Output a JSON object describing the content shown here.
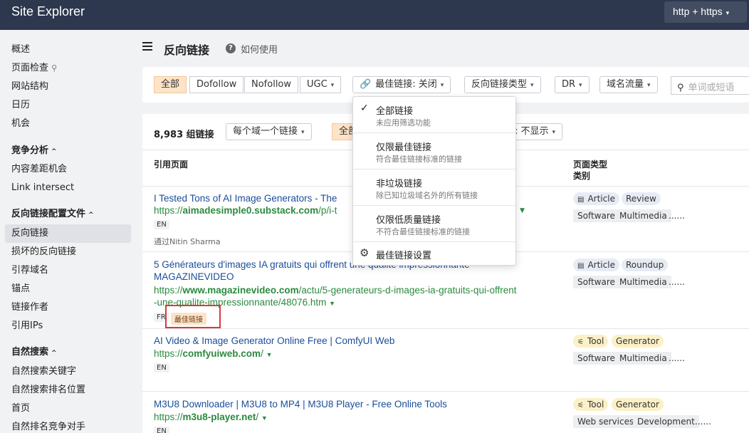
{
  "app": {
    "title": "Site Explorer",
    "protocol": "http + https"
  },
  "sidebar": {
    "items_top": [
      "概述",
      "页面检查",
      "网站结构",
      "日历",
      "机会"
    ],
    "section_competitive": {
      "label": "竞争分析",
      "items": [
        "内容差距机会",
        "Link intersect"
      ]
    },
    "section_backlinks": {
      "label": "反向链接配置文件",
      "items": [
        "反向链接",
        "损坏的反向链接",
        "引荐域名",
        "锚点",
        "链接作者",
        "引用IPs"
      ]
    },
    "section_organic": {
      "label": "自然搜索",
      "items": [
        "自然搜索关键字",
        "自然搜索排名位置",
        "首页",
        "自然排名竞争对手"
      ]
    }
  },
  "header": {
    "title": "反向链接",
    "help": "如何使用"
  },
  "filters": {
    "all": "全部",
    "dofollow": "Dofollow",
    "nofollow": "Nofollow",
    "ugc": "UGC",
    "best_links": "最佳链接: 关闭",
    "link_type": "反向链接类型",
    "dr": "DR",
    "domain_traffic": "域名流量",
    "search_placeholder": "单词或短语"
  },
  "table": {
    "count": "8,983 组链接",
    "group_select": "每个域一个链接",
    "all_btn": "全部",
    "hidden_select": ": 不显示",
    "col_ref_page": "引用页面",
    "col_page_type": "页面类型",
    "col_category": "类别",
    "rows": [
      {
        "title": "I Tested Tons of AI Image Generators - The",
        "url_prefix": "https://",
        "url_domain": "aimadesimple0.substack.com",
        "url_path": "/p/i-t",
        "lang": "EN",
        "via": "通过Nitin Sharma",
        "type_tags": [
          "Article",
          "Review"
        ],
        "cat_tags": [
          "Software",
          "Multimedia"
        ],
        "more": "......"
      },
      {
        "title_line1": "5 Générateurs d'images IA gratuits qui offrent une qualité impressionnante",
        "title_line2": "MAGAZINEVIDEO",
        "url_prefix": "https://",
        "url_domain": "www.magazinevideo.com",
        "url_path": "/actu/5-generateurs-d-images-ia-gratuits-qui-offrent",
        "url_line2": "-une-qualite-impressionnante/48076.htm",
        "lang": "FR",
        "best_tag": "最佳链接",
        "type_tags": [
          "Article",
          "Roundup"
        ],
        "cat_tags": [
          "Software",
          "Multimedia"
        ],
        "more": "......"
      },
      {
        "title": "AI Video & Image Generator Online Free | ComfyUI Web",
        "url_prefix": "https://",
        "url_domain": "comfyuiweb.com",
        "url_path": "/",
        "lang": "EN",
        "type_tags": [
          "Tool",
          "Generator"
        ],
        "cat_tags": [
          "Software",
          "Multimedia"
        ],
        "more": "......"
      },
      {
        "title": "M3U8 Downloader | M3U8 to MP4 | M3U8 Player - Free Online Tools",
        "url_prefix": "https://",
        "url_domain": "m3u8-player.net",
        "url_path": "/",
        "lang": "EN",
        "type_tags": [
          "Tool",
          "Generator"
        ],
        "cat_tags": [
          "Web services",
          "Development"
        ],
        "more": "......"
      }
    ]
  },
  "menu": {
    "items": [
      {
        "title": "全部链接",
        "sub": "未应用筛选功能"
      },
      {
        "title": "仅限最佳链接",
        "sub": "符合最佳链接标准的链接"
      },
      {
        "title": "非垃圾链接",
        "sub": "除已知垃圾域名外的所有链接"
      },
      {
        "title": "仅限低质量链接",
        "sub": "不符合最佳链接标准的链接"
      }
    ],
    "settings": "最佳链接设置"
  }
}
